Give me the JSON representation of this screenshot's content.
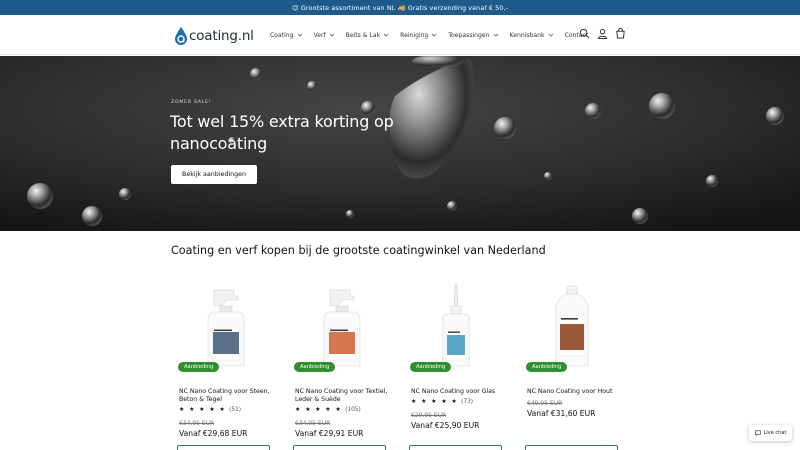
{
  "announcement": "😉 Grootste assortiment van NL 🚚 Gratis verzending vanaf € 50,-",
  "logo": {
    "text": "coating.nl"
  },
  "nav": [
    {
      "label": "Coating"
    },
    {
      "label": "Verf"
    },
    {
      "label": "Beits & Lak"
    },
    {
      "label": "Reiniging"
    },
    {
      "label": "Toepassingen"
    },
    {
      "label": "Kennisbank"
    },
    {
      "label": "Contact"
    }
  ],
  "header_icons": [
    "search-icon",
    "account-icon",
    "cart-icon"
  ],
  "hero": {
    "eyebrow": "ZOMER SALE!",
    "title": "Tot wel 15% extra korting op nanocoating",
    "button": "Bekijk aanbiedingen"
  },
  "section_title": "Coating en verf kopen bij de grootste coatingwinkel van Nederland",
  "products": [
    {
      "badge": "Aanbieding",
      "name": "NC Nano Coating voor Steen, Beton & Tegel",
      "stars": "★ ★ ★ ★ ★",
      "reviews": "(51)",
      "old_price": "€34,95 EUR",
      "price": "Vanaf €29,68 EUR",
      "label_color": "#5a6f8a"
    },
    {
      "badge": "Aanbieding",
      "name": "NC Nano Coating voor Textiel, Leder & Suède",
      "stars": "★ ★ ★ ★ ★",
      "reviews": "(105)",
      "old_price": "€34,95 EUR",
      "price": "Vanaf €29,91 EUR",
      "label_color": "#d2774f"
    },
    {
      "badge": "Aanbieding",
      "name": "NC Nano Coating voor Glas",
      "stars": "★ ★ ★ ★ ★",
      "reviews": "(73)",
      "old_price": "€29,95 EUR",
      "price": "Vanaf €25,90 EUR",
      "label_color": "#5aa8c8"
    },
    {
      "badge": "Aanbieding",
      "name": "NC Nano Coating voor Hout",
      "stars": "",
      "reviews": "",
      "old_price": "€49,95 EUR",
      "price": "Vanaf €31,60 EUR",
      "label_color": "#9a5a3a"
    }
  ],
  "live_chat": "Live chat",
  "colors": {
    "announcement_bg": "#1d5c8a",
    "badge_green": "#2f8f2f",
    "button_border": "#2f6fa6"
  }
}
